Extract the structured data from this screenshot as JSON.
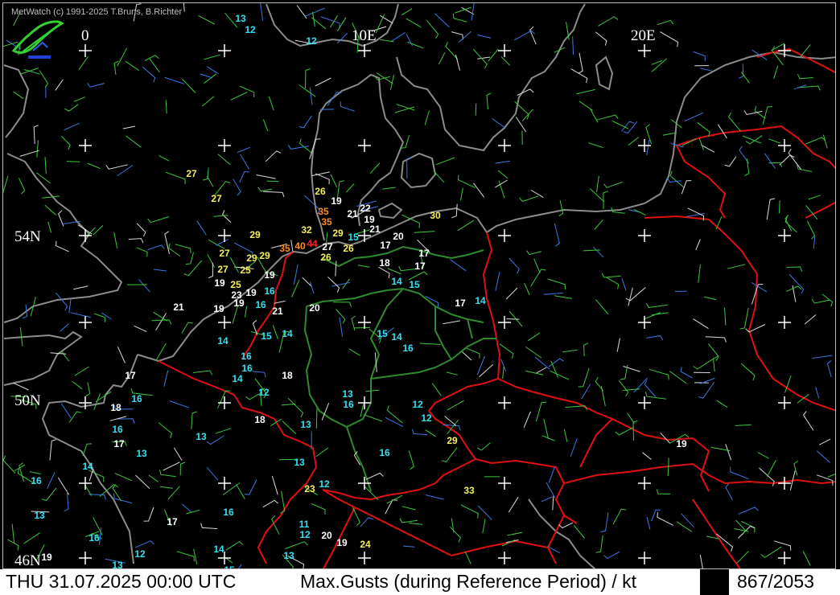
{
  "header": {
    "copyright": "MetWatch  (c) 1991-2025 T.Bruns, B.Richter"
  },
  "status": {
    "datetime": "THU 31.07.2025 00:00 UTC",
    "title": "Max.Gusts (during Reference Period) / kt",
    "count": "867/2053"
  },
  "grid": {
    "longitude_labels": [
      "0",
      "10E",
      "20E"
    ],
    "latitude_labels": [
      "54N",
      "50N",
      "46N"
    ]
  },
  "colors": {
    "background": "#000000",
    "coast": "#8c8c8c",
    "border": "#e01010",
    "state_border": "#2e8b2e",
    "grid_cross": "#ffffff",
    "wind_green": "#3cc83c",
    "wind_blue": "#3c78e6",
    "wind_white": "#dcdcdc",
    "gust_cyan": "#33e0f0",
    "gust_white": "#ffffff",
    "gust_yellow": "#f5f055",
    "gust_orange": "#ff8c1a",
    "gust_red": "#ff2020"
  },
  "logo_icon": "metwatch-logo-icon",
  "gust_labels": [
    {
      "v": "13",
      "c": "cyan"
    },
    {
      "v": "12",
      "c": "cyan"
    },
    {
      "v": "12",
      "c": "cyan"
    },
    {
      "v": "27",
      "c": "yellow"
    },
    {
      "v": "27",
      "c": "yellow"
    },
    {
      "v": "26",
      "c": "yellow"
    },
    {
      "v": "19",
      "c": "white"
    },
    {
      "v": "22",
      "c": "white"
    },
    {
      "v": "35",
      "c": "orange"
    },
    {
      "v": "35",
      "c": "orange"
    },
    {
      "v": "21",
      "c": "white"
    },
    {
      "v": "19",
      "c": "white"
    },
    {
      "v": "32",
      "c": "yellow"
    },
    {
      "v": "29",
      "c": "yellow"
    },
    {
      "v": "15",
      "c": "cyan"
    },
    {
      "v": "21",
      "c": "white"
    },
    {
      "v": "30",
      "c": "yellow"
    },
    {
      "v": "20",
      "c": "white"
    },
    {
      "v": "17",
      "c": "white"
    },
    {
      "v": "29",
      "c": "yellow"
    },
    {
      "v": "35",
      "c": "orange"
    },
    {
      "v": "40",
      "c": "orange"
    },
    {
      "v": "44",
      "c": "red"
    },
    {
      "v": "27",
      "c": "white"
    },
    {
      "v": "26",
      "c": "yellow"
    },
    {
      "v": "26",
      "c": "yellow"
    },
    {
      "v": "17",
      "c": "white"
    },
    {
      "v": "27",
      "c": "yellow"
    },
    {
      "v": "29",
      "c": "yellow"
    },
    {
      "v": "29",
      "c": "yellow"
    },
    {
      "v": "18",
      "c": "white"
    },
    {
      "v": "17",
      "c": "white"
    },
    {
      "v": "27",
      "c": "yellow"
    },
    {
      "v": "25",
      "c": "yellow"
    },
    {
      "v": "19",
      "c": "white"
    },
    {
      "v": "14",
      "c": "cyan"
    },
    {
      "v": "15",
      "c": "cyan"
    },
    {
      "v": "19",
      "c": "white"
    },
    {
      "v": "25",
      "c": "yellow"
    },
    {
      "v": "23",
      "c": "white"
    },
    {
      "v": "19",
      "c": "white"
    },
    {
      "v": "16",
      "c": "cyan"
    },
    {
      "v": "19",
      "c": "white"
    },
    {
      "v": "16",
      "c": "cyan"
    },
    {
      "v": "21",
      "c": "white"
    },
    {
      "v": "20",
      "c": "white"
    },
    {
      "v": "17",
      "c": "white"
    },
    {
      "v": "14",
      "c": "cyan"
    },
    {
      "v": "21",
      "c": "white"
    },
    {
      "v": "19",
      "c": "white"
    },
    {
      "v": "15",
      "c": "cyan"
    },
    {
      "v": "14",
      "c": "cyan"
    },
    {
      "v": "14",
      "c": "cyan"
    },
    {
      "v": "16",
      "c": "cyan"
    },
    {
      "v": "15",
      "c": "cyan"
    },
    {
      "v": "14",
      "c": "cyan"
    },
    {
      "v": "16",
      "c": "cyan"
    },
    {
      "v": "16",
      "c": "cyan"
    },
    {
      "v": "17",
      "c": "white"
    },
    {
      "v": "14",
      "c": "cyan"
    },
    {
      "v": "18",
      "c": "white"
    },
    {
      "v": "12",
      "c": "cyan"
    },
    {
      "v": "13",
      "c": "cyan"
    },
    {
      "v": "16",
      "c": "cyan"
    },
    {
      "v": "18",
      "c": "white"
    },
    {
      "v": "16",
      "c": "cyan"
    },
    {
      "v": "12",
      "c": "cyan"
    },
    {
      "v": "12",
      "c": "cyan"
    },
    {
      "v": "18",
      "c": "white"
    },
    {
      "v": "13",
      "c": "cyan"
    },
    {
      "v": "16",
      "c": "cyan"
    },
    {
      "v": "13",
      "c": "cyan"
    },
    {
      "v": "29",
      "c": "yellow"
    },
    {
      "v": "17",
      "c": "white"
    },
    {
      "v": "13",
      "c": "cyan"
    },
    {
      "v": "16",
      "c": "cyan"
    },
    {
      "v": "19",
      "c": "white"
    },
    {
      "v": "14",
      "c": "cyan"
    },
    {
      "v": "13",
      "c": "cyan"
    },
    {
      "v": "16",
      "c": "cyan"
    },
    {
      "v": "23",
      "c": "yellow"
    },
    {
      "v": "12",
      "c": "cyan"
    },
    {
      "v": "33",
      "c": "yellow"
    },
    {
      "v": "13",
      "c": "cyan"
    },
    {
      "v": "16",
      "c": "cyan"
    },
    {
      "v": "17",
      "c": "white"
    },
    {
      "v": "11",
      "c": "cyan"
    },
    {
      "v": "16",
      "c": "cyan"
    },
    {
      "v": "12",
      "c": "cyan"
    },
    {
      "v": "20",
      "c": "white"
    },
    {
      "v": "19",
      "c": "white"
    },
    {
      "v": "24",
      "c": "yellow"
    },
    {
      "v": "12",
      "c": "cyan"
    },
    {
      "v": "14",
      "c": "cyan"
    },
    {
      "v": "13",
      "c": "cyan"
    },
    {
      "v": "19",
      "c": "white"
    },
    {
      "v": "13",
      "c": "cyan"
    },
    {
      "v": "15",
      "c": "cyan"
    }
  ]
}
